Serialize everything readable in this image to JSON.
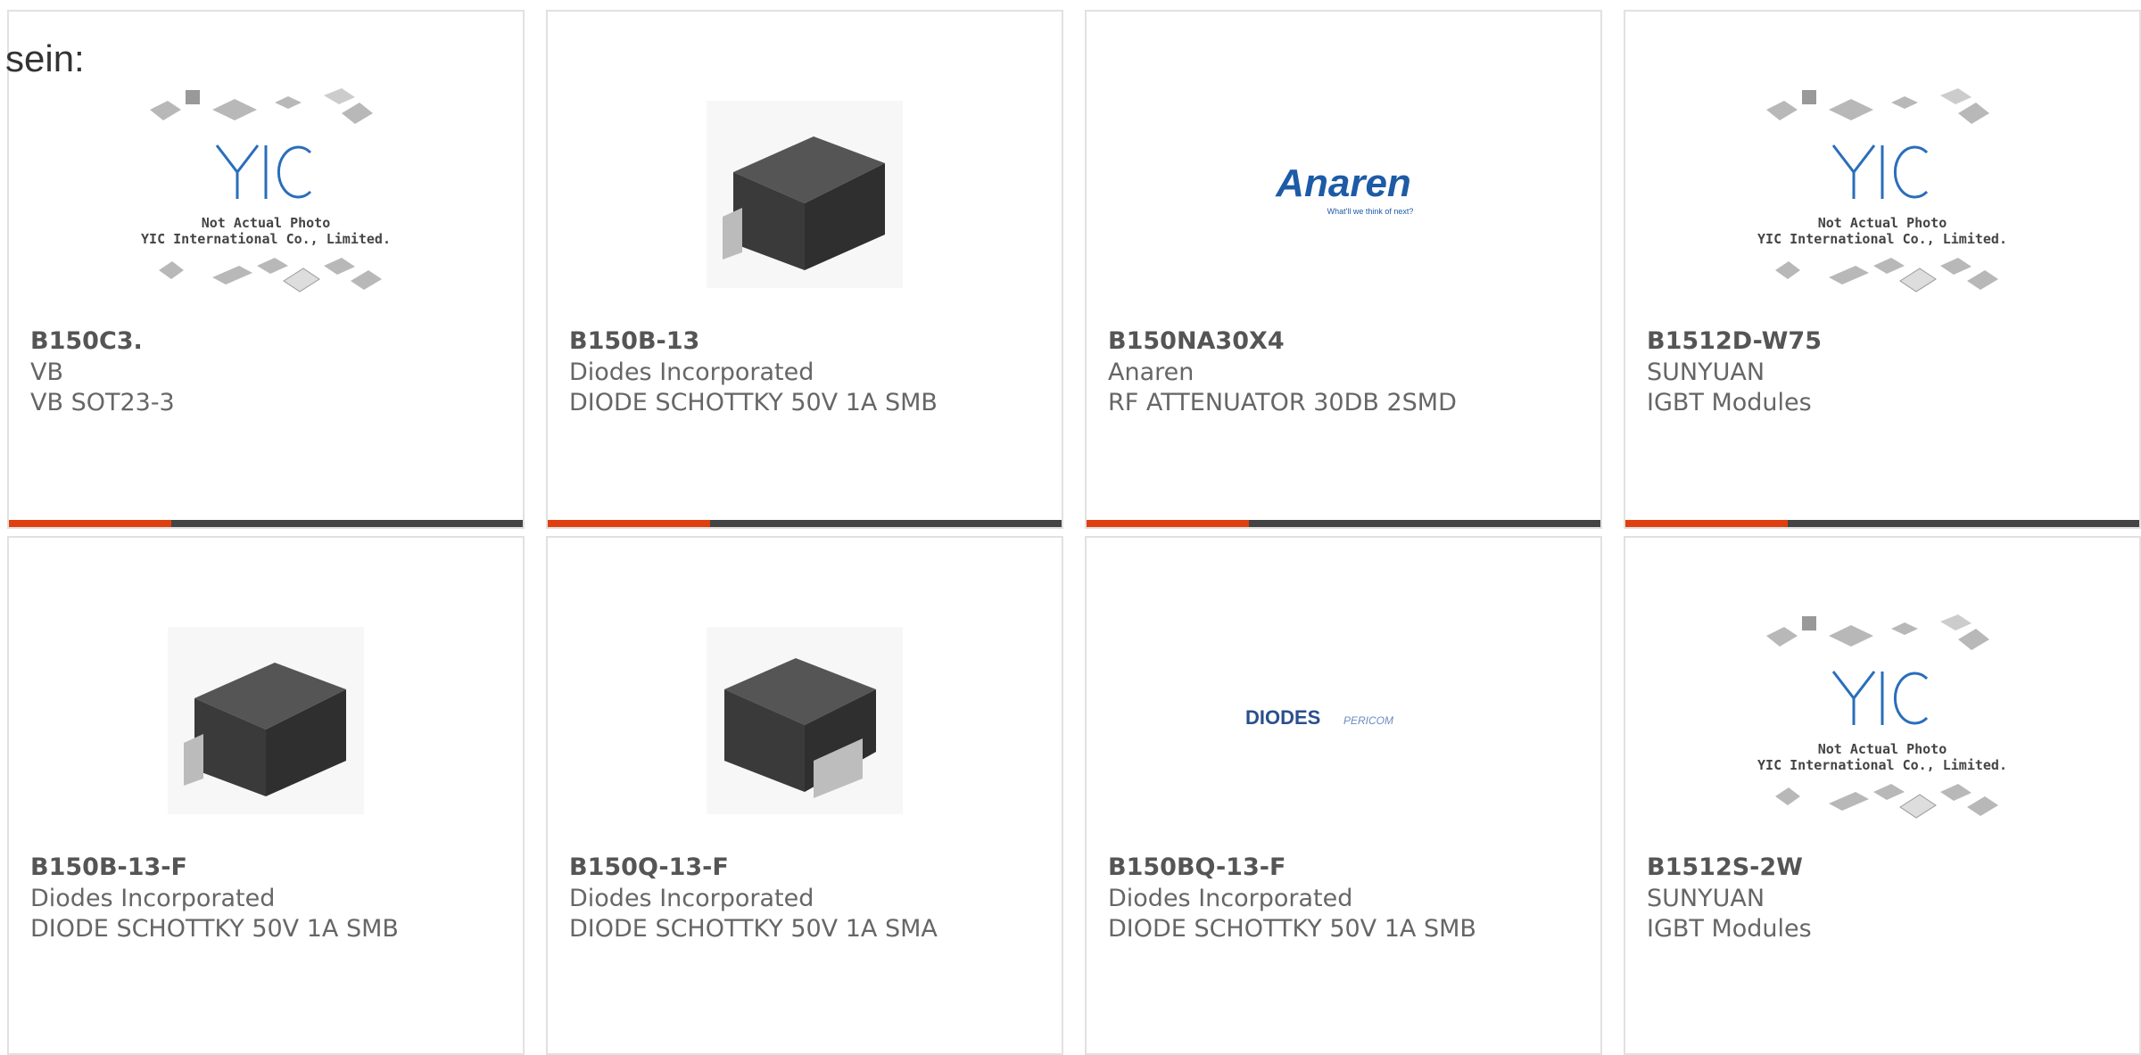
{
  "lead_text": "sein:",
  "colors": {
    "accent": "#e0400f",
    "bar": "#444444",
    "border": "#e1e1e1"
  },
  "placeholder": {
    "line1": "Not Actual Photo",
    "line2": "YIC International Co., Limited.",
    "logo": "YIC"
  },
  "products": [
    {
      "part": "B150C3.",
      "maker": "VB",
      "desc": "VB SOT23-3",
      "image": "placeholder"
    },
    {
      "part": "B150B-13",
      "maker": "Diodes Incorporated",
      "desc": "DIODE SCHOTTKY 50V 1A SMB",
      "image": "smb-package"
    },
    {
      "part": "B150NA30X4",
      "maker": "Anaren",
      "desc": "RF ATTENUATOR 30DB 2SMD",
      "image": "anaren-logo",
      "logo_text": "Anaren",
      "logo_tagline": "What'll we think of next?"
    },
    {
      "part": "B1512D-W75",
      "maker": "SUNYUAN",
      "desc": "IGBT Modules",
      "image": "placeholder"
    },
    {
      "part": "B150B-13-F",
      "maker": "Diodes Incorporated",
      "desc": "DIODE SCHOTTKY 50V 1A SMB",
      "image": "smb-package"
    },
    {
      "part": "B150Q-13-F",
      "maker": "Diodes Incorporated",
      "desc": "DIODE SCHOTTKY 50V 1A SMA",
      "image": "sma-package"
    },
    {
      "part": "B150BQ-13-F",
      "maker": "Diodes Incorporated",
      "desc": "DIODE SCHOTTKY 50V 1A SMB",
      "image": "diodes-logo",
      "logo_text": "DIODES",
      "logo_text2": "PERICOM"
    },
    {
      "part": "B1512S-2W",
      "maker": "SUNYUAN",
      "desc": "IGBT Modules",
      "image": "placeholder"
    }
  ]
}
